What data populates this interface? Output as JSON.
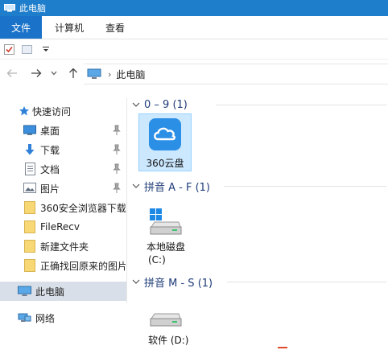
{
  "window": {
    "title": "此电脑"
  },
  "ribbon": {
    "tabs": [
      {
        "label": "文件",
        "active": true
      },
      {
        "label": "计算机",
        "active": false
      },
      {
        "label": "查看",
        "active": false
      }
    ]
  },
  "quick_access_toolbar": {
    "items": [
      "properties-icon",
      "new-folder-icon",
      "customize-dropdown-icon"
    ]
  },
  "address_bar": {
    "back_icon": "arrow-left-icon",
    "forward_icon": "arrow-right-icon",
    "recent_icon": "chevron-down-icon",
    "up_icon": "arrow-up-icon",
    "location_icon": "computer-icon",
    "separator": "›",
    "path": "此电脑"
  },
  "nav_pane": {
    "quick_access": {
      "label": "快速访问",
      "icon": "star-icon"
    },
    "pinned": [
      {
        "label": "桌面",
        "icon": "desktop-icon"
      },
      {
        "label": "下载",
        "icon": "download-arrow-icon"
      },
      {
        "label": "文档",
        "icon": "document-icon"
      },
      {
        "label": "图片",
        "icon": "picture-icon"
      }
    ],
    "folders": [
      {
        "label": "360安全浏览器下载",
        "icon": "folder-icon"
      },
      {
        "label": "FileRecv",
        "icon": "folder-icon"
      },
      {
        "label": "新建文件夹",
        "icon": "folder-icon"
      },
      {
        "label": "正确找回原来的图片",
        "icon": "folder-icon"
      }
    ],
    "this_pc": {
      "label": "此电脑",
      "icon": "computer-icon",
      "selected": true
    },
    "network": {
      "label": "网络",
      "icon": "network-icon"
    }
  },
  "content": {
    "groups": [
      {
        "header": "0 – 9 (1)",
        "items": [
          {
            "label": "360云盘",
            "icon": "cloud-app-icon",
            "selected": true
          }
        ]
      },
      {
        "header": "拼音 A - F (1)",
        "items": [
          {
            "label": "本地磁盘",
            "sublabel": "(C:)",
            "icon": "system-drive-icon"
          }
        ]
      },
      {
        "header": "拼音 M - S (1)",
        "items": [
          {
            "label": "软件 (D:)",
            "icon": "drive-icon"
          }
        ]
      }
    ]
  },
  "colors": {
    "titlebar": "#1f7ecb",
    "active_tab": "#1a73c9",
    "group_header": "#1f3c78",
    "selection": "#cce8ff",
    "nav_selected": "#d8dfe8",
    "cloud_blue": "#2b8fe6",
    "folder_yellow": "#f8d775"
  }
}
